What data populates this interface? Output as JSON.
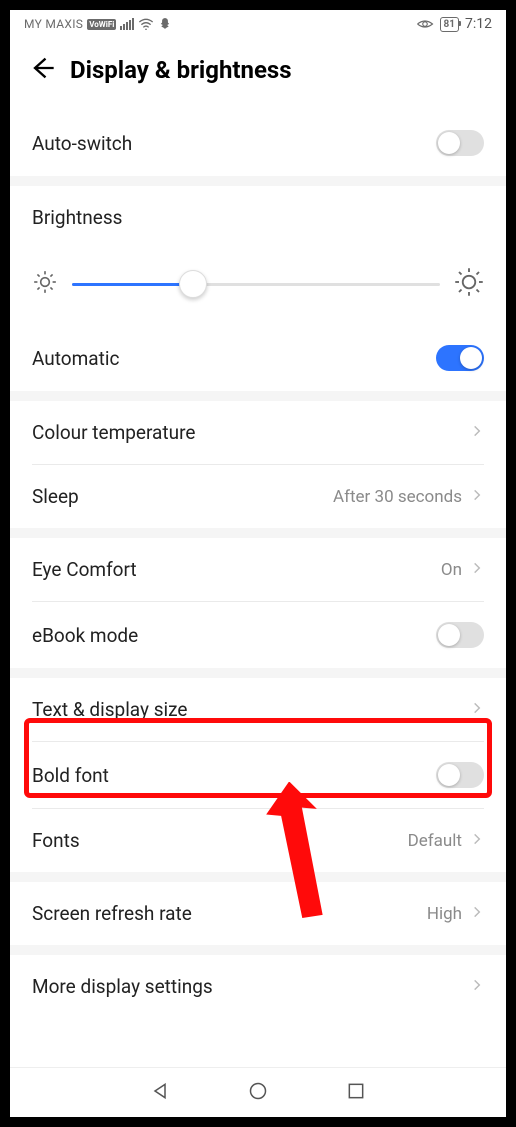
{
  "status_bar": {
    "carrier": "MY MAXIS",
    "vowifi": "VoWiFi",
    "battery_percent": "81",
    "time": "7:12"
  },
  "header": {
    "title": "Display & brightness"
  },
  "rows": {
    "auto_switch": {
      "label": "Auto-switch",
      "enabled": false
    },
    "brightness": {
      "label": "Brightness",
      "slider_percent": 33
    },
    "automatic": {
      "label": "Automatic",
      "enabled": true
    },
    "colour_temperature": {
      "label": "Colour temperature"
    },
    "sleep": {
      "label": "Sleep",
      "value": "After 30 seconds"
    },
    "eye_comfort": {
      "label": "Eye Comfort",
      "value": "On"
    },
    "ebook_mode": {
      "label": "eBook mode",
      "enabled": false
    },
    "text_display_size": {
      "label": "Text & display size"
    },
    "bold_font": {
      "label": "Bold font",
      "enabled": false
    },
    "fonts": {
      "label": "Fonts",
      "value": "Default"
    },
    "screen_refresh": {
      "label": "Screen refresh rate",
      "value": "High"
    },
    "more_display": {
      "label": "More display settings"
    }
  },
  "annotation": {
    "highlighted_row": "text_display_size"
  }
}
